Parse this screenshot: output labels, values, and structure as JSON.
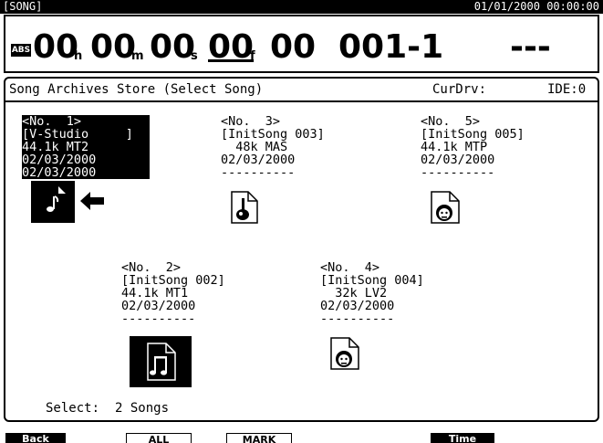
{
  "status_bar": {
    "screen": "[SONG]",
    "datetime": "01/01/2000 00:00:00"
  },
  "time_display": {
    "badge": "ABS",
    "hours": "00",
    "hours_unit": "h",
    "minutes": "00",
    "minutes_unit": "m",
    "seconds": "00",
    "seconds_unit": "s",
    "frames": "00",
    "frames_unit": "f",
    "subframes": "00",
    "measure_beat": "001-1",
    "marker": "---"
  },
  "header": {
    "title": "Song Archives Store (Select Song)",
    "drive_label": "CurDrv:",
    "drive_value": "IDE:0"
  },
  "songs": [
    {
      "no": "<No.  1>",
      "name": "[V-Studio     ]",
      "format": "44.1k MT2",
      "date1": "02/03/2000",
      "date2": "02/03/2000",
      "selected": true
    },
    {
      "no": "<No.  2>",
      "name": "[InitSong 002]",
      "format": "44.1k MT1",
      "date1": "02/03/2000",
      "date2": "----------",
      "selected": false
    },
    {
      "no": "<No.  3>",
      "name": "[InitSong 003]",
      "format": "  48k MAS",
      "date1": "02/03/2000",
      "date2": "----------",
      "selected": false
    },
    {
      "no": "<No.  4>",
      "name": "[InitSong 004]",
      "format": "  32k LV2",
      "date1": "02/03/2000",
      "date2": "----------",
      "selected": false
    },
    {
      "no": "<No.  5>",
      "name": "[InitSong 005]",
      "format": "44.1k MTP",
      "date1": "02/03/2000",
      "date2": "----------",
      "selected": false
    }
  ],
  "icons": {
    "song1": "music-note-icon",
    "song2": "double-music-note-icon",
    "song3": "guitar-icon",
    "song4": "face-icon",
    "song5": "face-icon",
    "pointer": "left-arrow-icon"
  },
  "footer": {
    "select_label": "Select:",
    "select_value": "2 Songs"
  },
  "function_buttons": {
    "back": "Back",
    "all": "ALL",
    "mark": "MARK",
    "time": "Time"
  }
}
